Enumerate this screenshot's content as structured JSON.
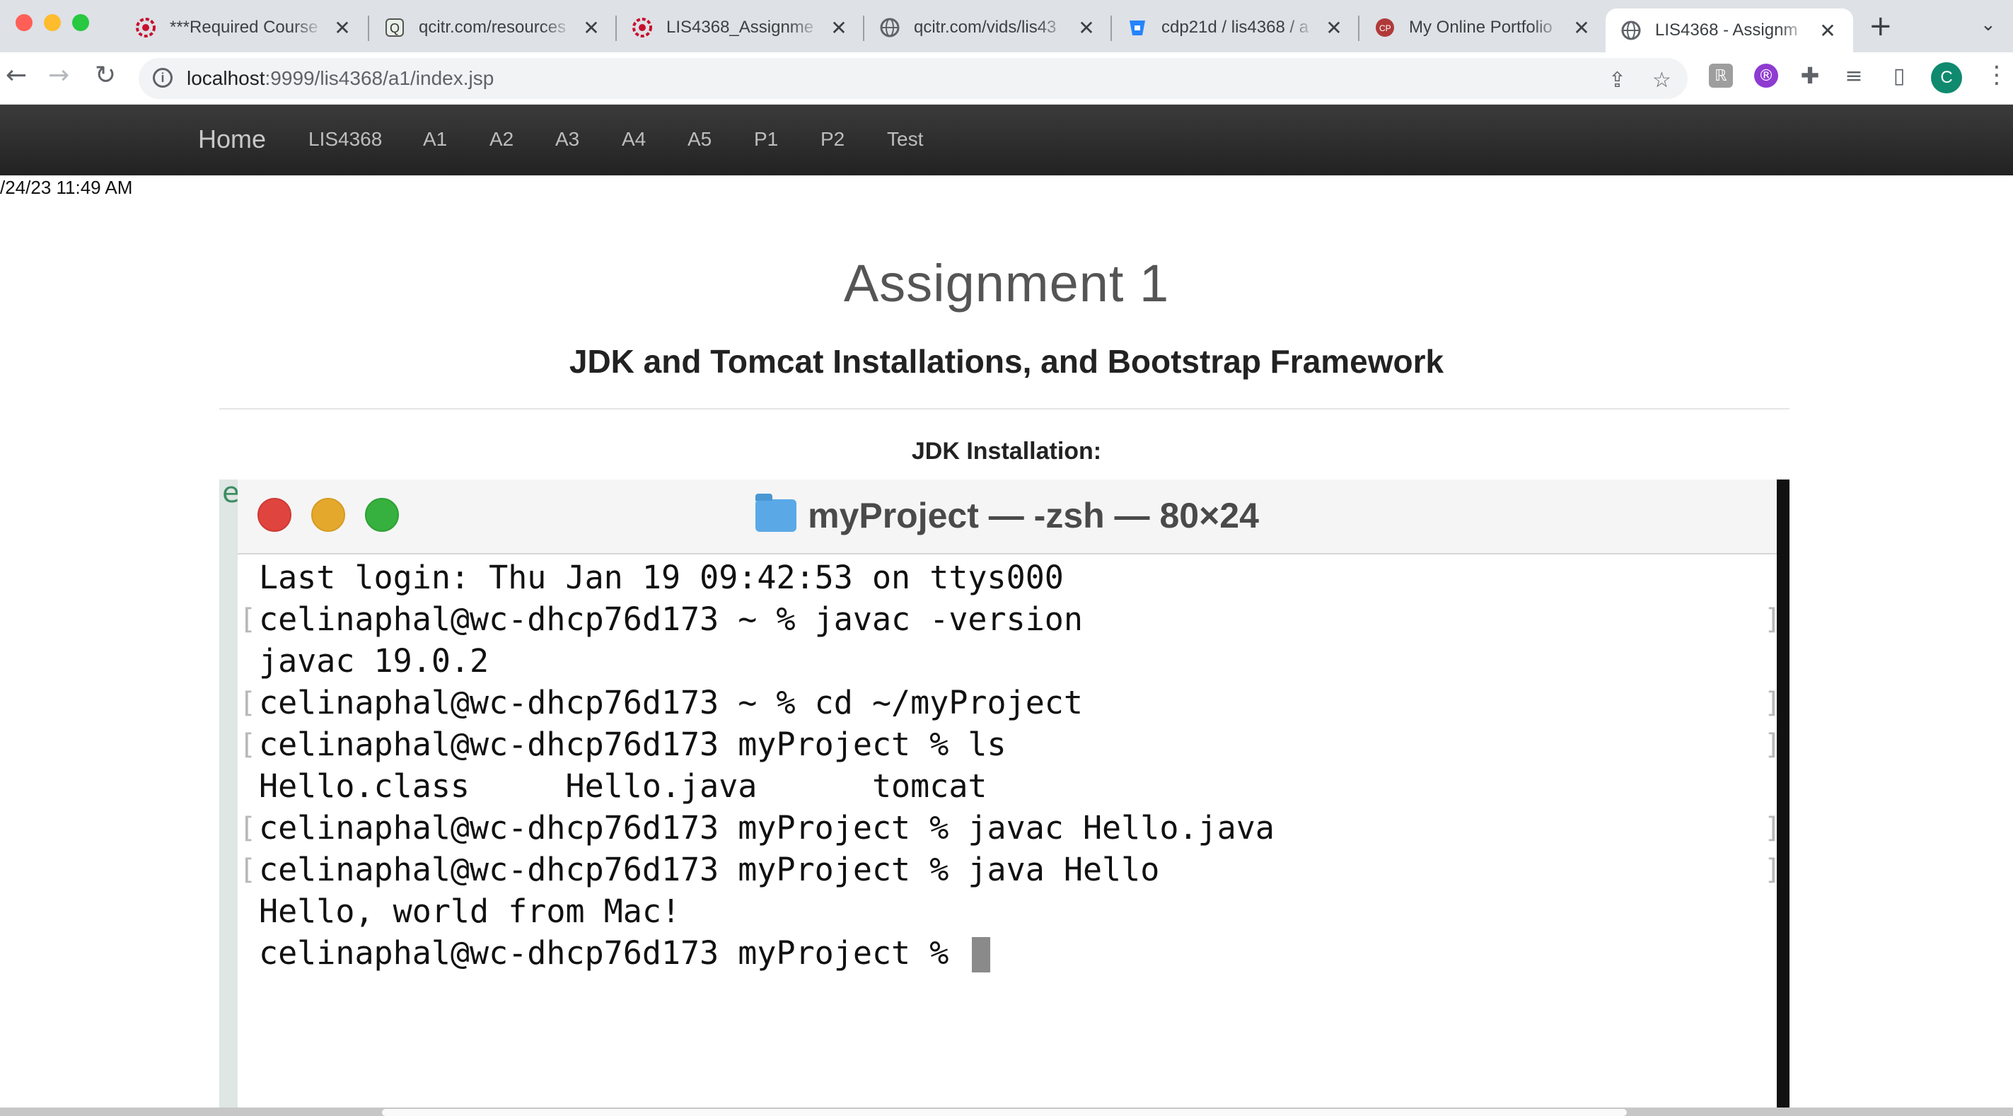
{
  "browser": {
    "tabs": [
      {
        "title": "***Required Course",
        "favicon": "gear-red-icon",
        "active": false
      },
      {
        "title": "qcitr.com/resources",
        "favicon": "q-icon",
        "active": false
      },
      {
        "title": "LIS4368_Assignme",
        "favicon": "gear-red-icon",
        "active": false
      },
      {
        "title": "qcitr.com/vids/lis43",
        "favicon": "globe-icon",
        "active": false
      },
      {
        "title": "cdp21d / lis4368 / a",
        "favicon": "bitbucket-icon",
        "active": false
      },
      {
        "title": "My Online Portfolio",
        "favicon": "portfolio-icon",
        "active": false
      },
      {
        "title": "LIS4368 - Assignm",
        "favicon": "globe-icon",
        "active": true
      }
    ],
    "url_host": "localhost",
    "url_path": ":9999/lis4368/a1/index.jsp",
    "profile_initial": "C"
  },
  "site_nav": {
    "brand": "Home",
    "links": [
      "LIS4368",
      "A1",
      "A2",
      "A3",
      "A4",
      "A5",
      "P1",
      "P2",
      "Test"
    ]
  },
  "timestamp": "/24/23 11:49 AM",
  "page": {
    "title": "Assignment 1",
    "subtitle": "JDK and Tomcat Installations, and Bootstrap Framework",
    "section_heading": "JDK Installation:"
  },
  "terminal": {
    "title": "myProject — -zsh — 80×24",
    "lines": [
      {
        "text": "Last login: Thu Jan 19 09:42:53 on ttys000",
        "brackets": false
      },
      {
        "text": "celinaphal@wc-dhcp76d173 ~ % javac -version",
        "brackets": true
      },
      {
        "text": "javac 19.0.2",
        "brackets": false
      },
      {
        "text": "celinaphal@wc-dhcp76d173 ~ % cd ~/myProject",
        "brackets": true
      },
      {
        "text": "celinaphal@wc-dhcp76d173 myProject % ls",
        "brackets": true
      },
      {
        "text": "Hello.class     Hello.java      tomcat",
        "brackets": false
      },
      {
        "text": "celinaphal@wc-dhcp76d173 myProject % javac Hello.java",
        "brackets": true
      },
      {
        "text": "celinaphal@wc-dhcp76d173 myProject % java Hello",
        "brackets": true
      },
      {
        "text": "Hello, world from Mac!",
        "brackets": false
      },
      {
        "text": "celinaphal@wc-dhcp76d173 myProject % ",
        "brackets": false,
        "cursor": true
      }
    ]
  },
  "colors": {
    "navbar_bg": "#222222",
    "tab_strip_bg": "#dee1e6",
    "profile_bg": "#0f8a6e"
  }
}
